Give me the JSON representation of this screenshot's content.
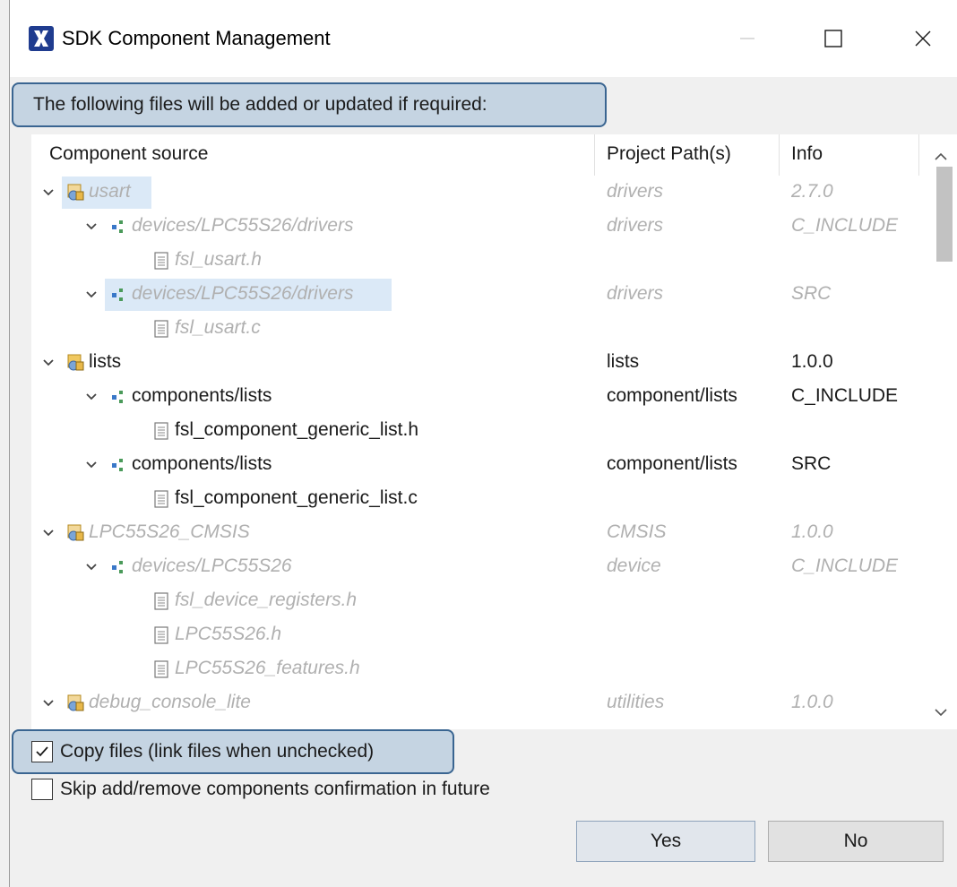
{
  "window": {
    "title": "SDK Component Management",
    "app_icon": "xilinx-x-icon",
    "controls": [
      "minimize-icon",
      "maximize-icon",
      "close-icon"
    ]
  },
  "header": {
    "message": "The following files will be added or updated if required:"
  },
  "tree": {
    "columns": [
      "Component source",
      "Project Path(s)",
      "Info"
    ],
    "rows": [
      {
        "level": 0,
        "kind": "component",
        "expanded": true,
        "name": "usart",
        "path": "drivers",
        "info": "2.7.0",
        "style": "dim-selected"
      },
      {
        "level": 1,
        "kind": "folder",
        "expanded": true,
        "name": "devices/LPC55S26/drivers",
        "path": "drivers",
        "info": "C_INCLUDE",
        "style": "dim"
      },
      {
        "level": 2,
        "kind": "file",
        "name": "fsl_usart.h",
        "path": "",
        "info": "",
        "style": "dim"
      },
      {
        "level": 1,
        "kind": "folder",
        "expanded": true,
        "name": "devices/LPC55S26/drivers",
        "path": "drivers",
        "info": "SRC",
        "style": "dim-selected"
      },
      {
        "level": 2,
        "kind": "file",
        "name": "fsl_usart.c",
        "path": "",
        "info": "",
        "style": "dim"
      },
      {
        "level": 0,
        "kind": "component",
        "expanded": true,
        "name": "lists",
        "path": "lists",
        "info": "1.0.0",
        "style": "normal"
      },
      {
        "level": 1,
        "kind": "folder",
        "expanded": true,
        "name": "components/lists",
        "path": "component/lists",
        "info": "C_INCLUDE",
        "style": "normal"
      },
      {
        "level": 2,
        "kind": "file",
        "name": "fsl_component_generic_list.h",
        "path": "",
        "info": "",
        "style": "normal"
      },
      {
        "level": 1,
        "kind": "folder",
        "expanded": true,
        "name": "components/lists",
        "path": "component/lists",
        "info": "SRC",
        "style": "normal"
      },
      {
        "level": 2,
        "kind": "file",
        "name": "fsl_component_generic_list.c",
        "path": "",
        "info": "",
        "style": "normal"
      },
      {
        "level": 0,
        "kind": "component",
        "expanded": true,
        "name": "LPC55S26_CMSIS",
        "path": "CMSIS",
        "info": "1.0.0",
        "style": "dim"
      },
      {
        "level": 1,
        "kind": "folder",
        "expanded": true,
        "name": "devices/LPC55S26",
        "path": "device",
        "info": "C_INCLUDE",
        "style": "dim"
      },
      {
        "level": 2,
        "kind": "file",
        "name": "fsl_device_registers.h",
        "path": "",
        "info": "",
        "style": "dim"
      },
      {
        "level": 2,
        "kind": "file",
        "name": "LPC55S26.h",
        "path": "",
        "info": "",
        "style": "dim"
      },
      {
        "level": 2,
        "kind": "file",
        "name": "LPC55S26_features.h",
        "path": "",
        "info": "",
        "style": "dim"
      },
      {
        "level": 0,
        "kind": "component",
        "expanded": true,
        "name": "debug_console_lite",
        "path": "utilities",
        "info": "1.0.0",
        "style": "dim"
      }
    ]
  },
  "options": {
    "copy_files": {
      "label": "Copy files (link files when unchecked)",
      "checked": true
    },
    "skip_confirmation": {
      "label": "Skip add/remove components confirmation in future",
      "checked": false
    }
  },
  "buttons": {
    "yes": "Yes",
    "no": "No"
  },
  "colors": {
    "highlight_fill": "#c5d4e2",
    "highlight_border": "#3a6591",
    "selection": "#dbe9f7",
    "dim_text": "#b0b0b0"
  }
}
